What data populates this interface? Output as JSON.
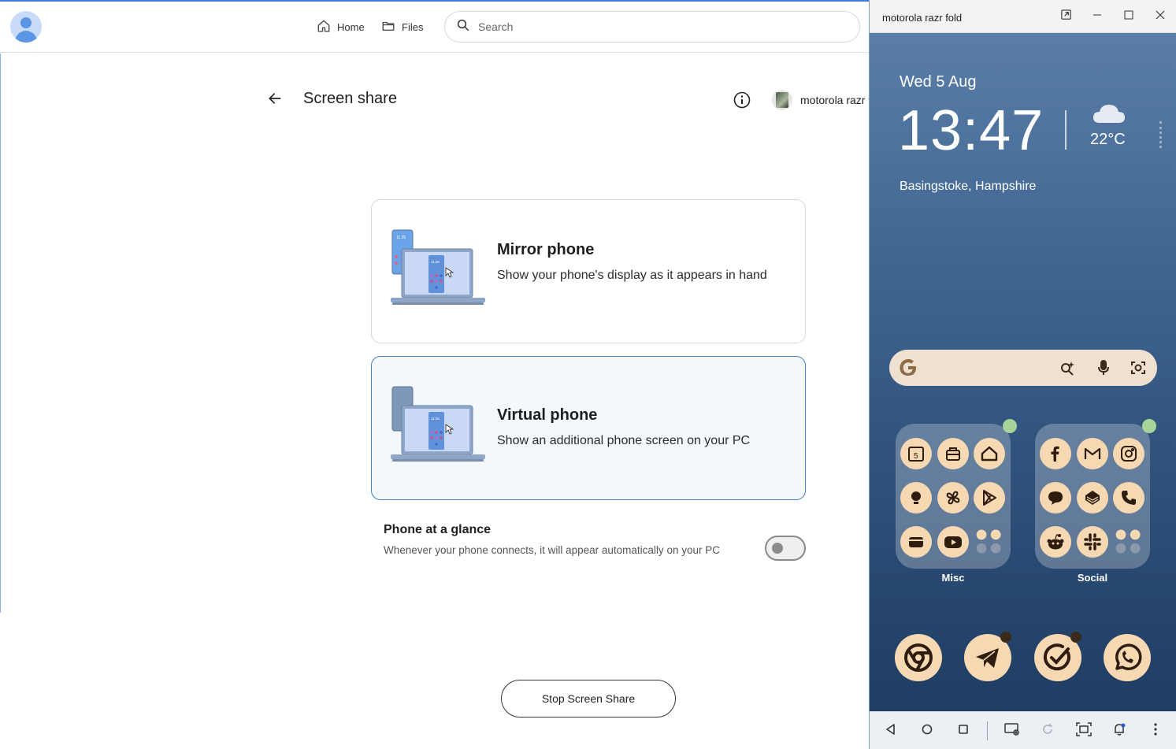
{
  "app": {
    "nav": {
      "home_label": "Home",
      "files_label": "Files"
    },
    "search": {
      "placeholder": "Search"
    },
    "page": {
      "title": "Screen share",
      "device_name": "motorola razr fold"
    },
    "options": {
      "mirror": {
        "title": "Mirror phone",
        "description": "Show your phone's display as it appears in hand"
      },
      "virtual": {
        "title": "Virtual phone",
        "description": "Show an additional phone screen on your PC"
      }
    },
    "glance": {
      "title": "Phone at a glance",
      "description": "Whenever your phone connects, it will appear automatically on your PC",
      "enabled": false
    },
    "stop_button_label": "Stop Screen Share",
    "colors": {
      "accent": "#4a7fc1",
      "selected_bg": "#f3f8fd"
    }
  },
  "phone_window": {
    "title": "motorola razr fold",
    "lockscreen": {
      "date": "Wed 5 Aug",
      "time": "13:47",
      "temperature": "22°C",
      "location": "Basingstoke, Hampshire"
    },
    "folders": [
      {
        "label": "Misc",
        "icons": [
          "calendar-icon",
          "stamp-icon",
          "home-icon",
          "bulb-icon",
          "pinwheel-icon",
          "play-store-icon",
          "wallet-icon",
          "youtube-icon",
          "mini-folder-icon"
        ]
      },
      {
        "label": "Social",
        "icons": [
          "facebook-icon",
          "gmail-icon",
          "instagram-icon",
          "chat-icon",
          "layers-icon",
          "phone-icon",
          "reddit-icon",
          "slack-icon",
          "mini-folder-icon"
        ]
      }
    ],
    "dock": [
      "chrome-icon",
      "telegram-icon",
      "tasks-icon",
      "whatsapp-icon"
    ],
    "colors": {
      "icon_bg": "#f6d9b3",
      "icon_fg": "#2e1d0e"
    }
  }
}
